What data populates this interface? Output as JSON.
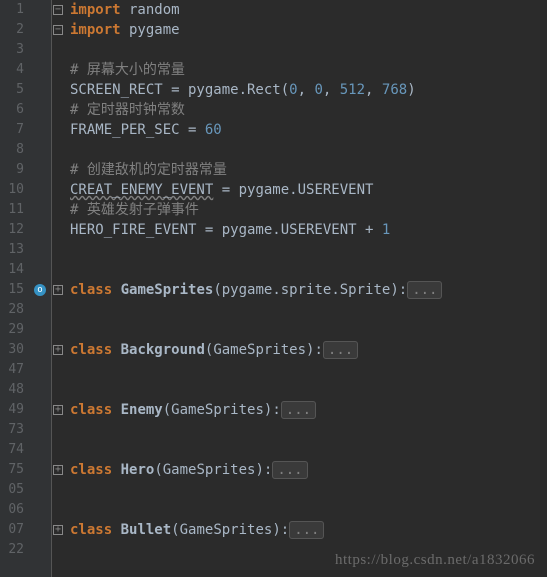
{
  "lines": [
    {
      "n": "1",
      "fold": "-",
      "tokens": [
        {
          "cls": "kw",
          "t": "import"
        },
        {
          "t": " random"
        }
      ]
    },
    {
      "n": "2",
      "fold": "-",
      "tokens": [
        {
          "cls": "kw",
          "t": "import"
        },
        {
          "t": " pygame"
        }
      ]
    },
    {
      "n": "3",
      "tokens": []
    },
    {
      "n": "4",
      "tokens": [
        {
          "cls": "comm",
          "t": "# 屏幕大小的常量"
        }
      ]
    },
    {
      "n": "5",
      "tokens": [
        {
          "t": "SCREEN_RECT = pygame.Rect("
        },
        {
          "cls": "num",
          "t": "0"
        },
        {
          "t": ", "
        },
        {
          "cls": "num",
          "t": "0"
        },
        {
          "t": ", "
        },
        {
          "cls": "num",
          "t": "512"
        },
        {
          "t": ", "
        },
        {
          "cls": "num",
          "t": "768"
        },
        {
          "t": ")"
        }
      ]
    },
    {
      "n": "6",
      "tokens": [
        {
          "cls": "comm",
          "t": "# 定时器时钟常数"
        }
      ]
    },
    {
      "n": "7",
      "tokens": [
        {
          "t": "FRAME_PER_SEC = "
        },
        {
          "cls": "num",
          "t": "60"
        }
      ]
    },
    {
      "n": "8",
      "tokens": []
    },
    {
      "n": "9",
      "tokens": [
        {
          "cls": "comm",
          "t": "# 创建敌机的定时器常量"
        }
      ]
    },
    {
      "n": "10",
      "tokens": [
        {
          "cls": "wavy",
          "t": "CREAT_ENEMY_EVENT"
        },
        {
          "t": " = pygame.USEREVENT"
        }
      ]
    },
    {
      "n": "11",
      "tokens": [
        {
          "cls": "comm",
          "t": "# 英雄发射子弹事件"
        }
      ]
    },
    {
      "n": "12",
      "tokens": [
        {
          "t": "HERO_FIRE_EVENT = pygame.USEREVENT + "
        },
        {
          "cls": "num",
          "t": "1"
        }
      ]
    },
    {
      "n": "13",
      "tokens": []
    },
    {
      "n": "14",
      "tokens": []
    },
    {
      "n": "15",
      "fold": "+",
      "icon": "o",
      "tokens": [
        {
          "cls": "kw",
          "t": "class"
        },
        {
          "t": " "
        },
        {
          "cls": "cls",
          "t": "GameSprites"
        },
        {
          "t": "(pygame.sprite.Sprite):"
        },
        {
          "folded": "..."
        }
      ]
    },
    {
      "n": "28",
      "tokens": []
    },
    {
      "n": "29",
      "tokens": []
    },
    {
      "n": "30",
      "fold": "+",
      "tokens": [
        {
          "cls": "kw",
          "t": "class"
        },
        {
          "t": " "
        },
        {
          "cls": "cls",
          "t": "Background"
        },
        {
          "t": "(GameSprites):"
        },
        {
          "folded": "..."
        }
      ]
    },
    {
      "n": "47",
      "tokens": []
    },
    {
      "n": "48",
      "tokens": []
    },
    {
      "n": "49",
      "fold": "+",
      "tokens": [
        {
          "cls": "kw",
          "t": "class"
        },
        {
          "t": " "
        },
        {
          "cls": "cls",
          "t": "Enemy"
        },
        {
          "t": "(GameSprites):"
        },
        {
          "folded": "..."
        }
      ]
    },
    {
      "n": "73",
      "tokens": []
    },
    {
      "n": "74",
      "tokens": []
    },
    {
      "n": "75",
      "fold": "+",
      "tokens": [
        {
          "cls": "kw",
          "t": "class"
        },
        {
          "t": " "
        },
        {
          "cls": "cls",
          "t": "Hero"
        },
        {
          "t": "(GameSprites):"
        },
        {
          "folded": "..."
        }
      ]
    },
    {
      "n": "05",
      "tokens": []
    },
    {
      "n": "06",
      "tokens": []
    },
    {
      "n": "07",
      "fold": "+",
      "tokens": [
        {
          "cls": "kw",
          "t": "class"
        },
        {
          "t": " "
        },
        {
          "cls": "cls",
          "t": "Bullet"
        },
        {
          "t": "(GameSprites):"
        },
        {
          "folded": "..."
        }
      ]
    },
    {
      "n": "22",
      "tokens": []
    }
  ],
  "watermark": "https://blog.csdn.net/a1832066"
}
